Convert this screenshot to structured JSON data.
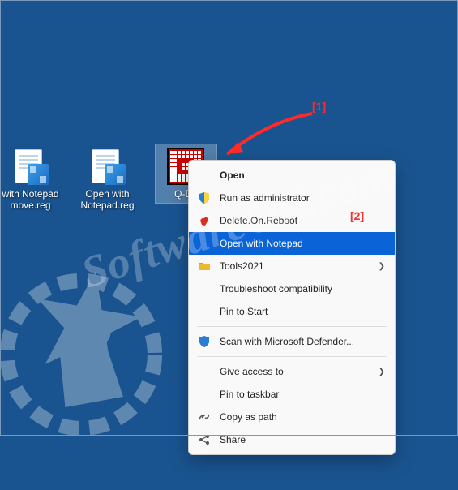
{
  "desktop": {
    "icons": [
      {
        "label": "with Notepad\nmove.reg"
      },
      {
        "label": "Open with\nNotepad.reg"
      },
      {
        "label": "Q-Dir"
      }
    ]
  },
  "menu": {
    "open": "Open",
    "run_as_admin": "Run as administrator",
    "delete_on_reboot": "Delete.On.Reboot",
    "open_with_notepad": "Open with Notepad",
    "tools2021": "Tools2021",
    "troubleshoot": "Troubleshoot compatibility",
    "pin_to_start": "Pin to Start",
    "scan_defender": "Scan with Microsoft Defender...",
    "give_access": "Give access to",
    "pin_to_taskbar": "Pin to taskbar",
    "copy_as_path": "Copy as path",
    "share": "Share"
  },
  "annotations": {
    "a1": "[1]",
    "a2": "[2]"
  },
  "watermark": "SoftwareOK.com"
}
